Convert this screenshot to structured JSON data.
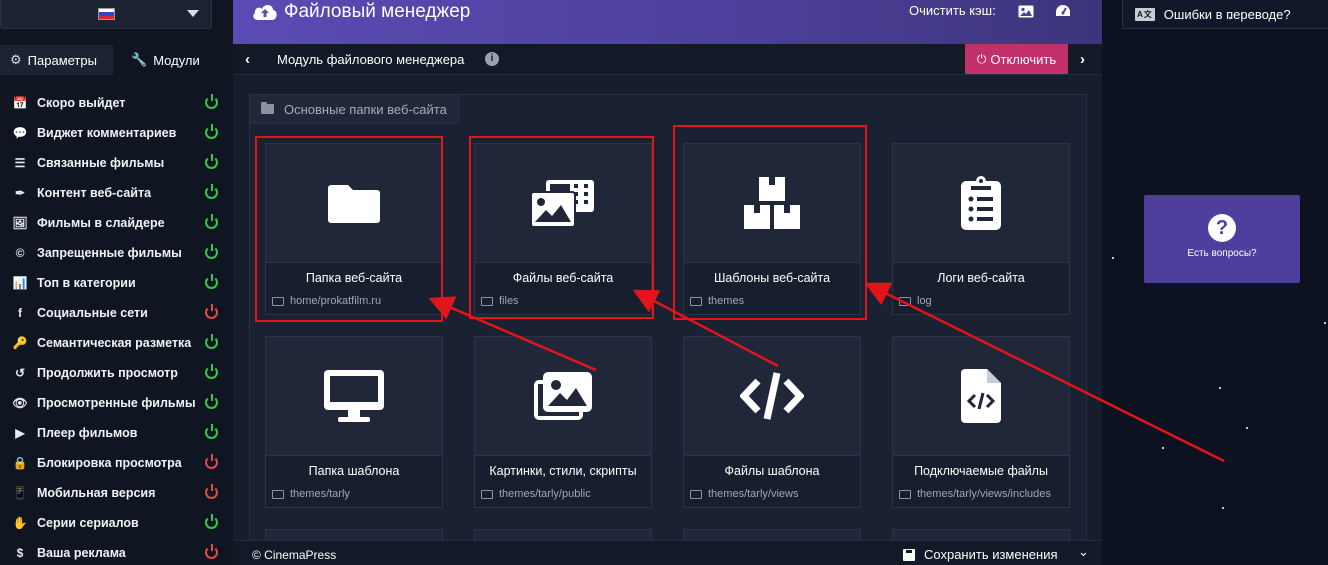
{
  "sidebar": {
    "language": "Русский",
    "tabs": [
      {
        "label": "Параметры",
        "icon": "gears-icon"
      },
      {
        "label": "Модули",
        "icon": "wrench-icon"
      }
    ],
    "modules": [
      {
        "label": "Скоро выйдет",
        "icon": "calendar-icon",
        "enabled": true
      },
      {
        "label": "Виджет комментариев",
        "icon": "comments-icon",
        "enabled": true
      },
      {
        "label": "Связанные фильмы",
        "icon": "list-icon",
        "enabled": true
      },
      {
        "label": "Контент веб-сайта",
        "icon": "pen-icon",
        "enabled": true
      },
      {
        "label": "Фильмы в слайдере",
        "icon": "images-icon",
        "enabled": true
      },
      {
        "label": "Запрещенные фильмы",
        "icon": "copyright-icon",
        "enabled": true
      },
      {
        "label": "Топ в категории",
        "icon": "chart-icon",
        "enabled": true
      },
      {
        "label": "Социальные сети",
        "icon": "facebook-icon",
        "enabled": false
      },
      {
        "label": "Семантическая разметка",
        "icon": "key-icon",
        "enabled": true
      },
      {
        "label": "Продолжить просмотр",
        "icon": "history-icon",
        "enabled": true
      },
      {
        "label": "Просмотренные фильмы",
        "icon": "eye-icon",
        "enabled": true
      },
      {
        "label": "Плеер фильмов",
        "icon": "play-icon",
        "enabled": true
      },
      {
        "label": "Блокировка просмотра",
        "icon": "lock-icon",
        "enabled": false
      },
      {
        "label": "Мобильная версия",
        "icon": "mobile-icon",
        "enabled": false
      },
      {
        "label": "Серии сериалов",
        "icon": "hand-icon",
        "enabled": true
      },
      {
        "label": "Ваша реклама",
        "icon": "dollar-icon",
        "enabled": false
      }
    ]
  },
  "header": {
    "title": "Файловый менеджер",
    "cache_label": "Очистить кэш:"
  },
  "subbar": {
    "breadcrumb": "Модуль файлового менеджера",
    "info": "i",
    "disable_label": "Отключить"
  },
  "panel": {
    "title": "Основные папки веб-сайта",
    "cards": [
      {
        "name": "Папка веб-сайта",
        "path": "home/prokatfilm.ru",
        "icon": "folder-icon"
      },
      {
        "name": "Файлы веб-сайта",
        "path": "files",
        "icon": "photo-film-icon"
      },
      {
        "name": "Шаблоны веб-сайта",
        "path": "themes",
        "icon": "boxes-icon"
      },
      {
        "name": "Логи веб-сайта",
        "path": "log",
        "icon": "clipboard-list-icon"
      },
      {
        "name": "Папка шаблона",
        "path": "themes/tarly",
        "icon": "desktop-icon"
      },
      {
        "name": "Картинки, стили, скрипты",
        "path": "themes/tarly/public",
        "icon": "images-icon"
      },
      {
        "name": "Файлы шаблона",
        "path": "themes/tarly/views",
        "icon": "code-icon"
      },
      {
        "name": "Подключаемые файлы",
        "path": "themes/tarly/views/includes",
        "icon": "file-code-icon"
      }
    ]
  },
  "footer": {
    "copyright": "© CinemaPress",
    "save_label": "Сохранить изменения"
  },
  "right": {
    "translation_errors": "Ошибки в переводе?",
    "translation_icon_text": "A文",
    "help_label": "Есть вопросы?",
    "help_icon_text": "?"
  },
  "colors": {
    "accent": "#5b4bb4",
    "danger_button": "#c2306a",
    "enabled": "#35c74b",
    "disabled": "#e04a4a",
    "highlight": "#e3141a"
  }
}
